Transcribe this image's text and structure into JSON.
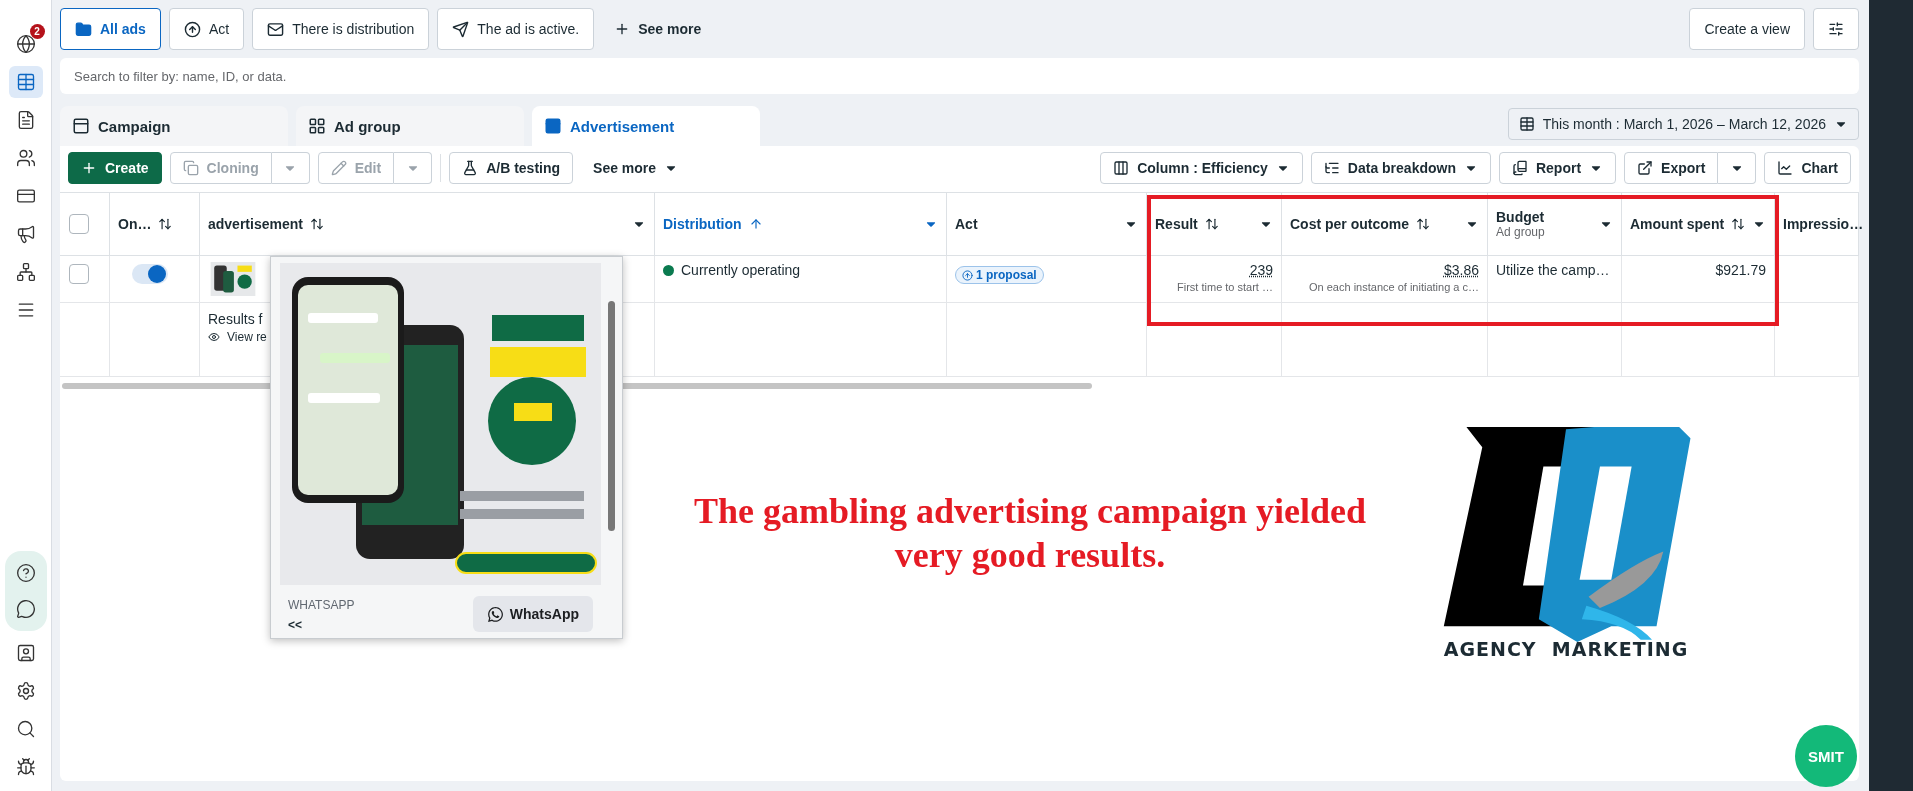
{
  "sidebar": {
    "top_items": [
      {
        "badge": "2",
        "selected": false
      },
      {
        "selected": true
      },
      {
        "selected": false
      },
      {
        "selected": false
      },
      {
        "selected": false
      },
      {
        "selected": false
      },
      {
        "selected": false
      },
      {
        "selected": false
      }
    ],
    "help_items": [
      {
        "selected": false
      },
      {
        "selected": false
      }
    ],
    "bottom_items": [
      {
        "selected": false
      },
      {
        "selected": false
      },
      {
        "selected": false
      },
      {
        "selected": false
      }
    ]
  },
  "filters": [
    {
      "label": "All ads",
      "selected": true
    },
    {
      "label": "Act",
      "selected": false
    },
    {
      "label": "There is distribution",
      "selected": false
    },
    {
      "label": "The ad is active.",
      "selected": false
    }
  ],
  "see_more_filters": "See more",
  "create_view": "Create a view",
  "search": {
    "placeholder": "Search to filter by: name, ID, or data."
  },
  "level_tabs": [
    {
      "label": "Campaign",
      "selected": false
    },
    {
      "label": "Ad group",
      "selected": false
    },
    {
      "label": "Advertisement",
      "selected": true
    }
  ],
  "date_range": "This month : March 1, 2026 – March 12, 2026",
  "toolbar_left": [
    {
      "kind": "primary",
      "label": "Create",
      "disabled": false
    },
    {
      "kind": "split",
      "label": "Cloning",
      "disabled": true
    },
    {
      "kind": "split",
      "label": "Edit",
      "disabled": true
    },
    {
      "kind": "outline",
      "label": "A/B testing",
      "disabled": false
    },
    {
      "kind": "menu",
      "label": "See more",
      "disabled": false
    }
  ],
  "toolbar_right": [
    {
      "kind": "menu",
      "label": "Column : Efficiency"
    },
    {
      "kind": "menu",
      "label": "Data breakdown"
    },
    {
      "kind": "menu",
      "label": "Report"
    },
    {
      "kind": "split",
      "label": "Export"
    },
    {
      "kind": "plain",
      "label": "Chart"
    }
  ],
  "table": {
    "all_checked": false,
    "columns": [
      {
        "label": "On…",
        "sortable": true,
        "menu": false,
        "active": false
      },
      {
        "label": "advertisement",
        "sortable": true,
        "menu": true,
        "active": false
      },
      {
        "label": "Distribution",
        "sortable": true,
        "menu": true,
        "active": true
      },
      {
        "label": "Act",
        "sortable": false,
        "menu": true,
        "active": false
      },
      {
        "label": "Result",
        "sortable": true,
        "menu": true,
        "active": false
      },
      {
        "label": "Cost per outcome",
        "sortable": true,
        "menu": true,
        "active": false
      },
      {
        "label": "Budget",
        "sublabel": "Ad group",
        "sortable": false,
        "menu": true,
        "active": false
      },
      {
        "label": "Amount spent",
        "sortable": true,
        "menu": true,
        "active": false
      },
      {
        "label": "Impressio…",
        "menu": false,
        "active": false
      }
    ],
    "row": {
      "checked": false,
      "on": true,
      "distribution": {
        "label": "Currently operating",
        "color": "#0a7a4f"
      },
      "proposal": "1 proposal",
      "result": "239",
      "result_note": "First time to start …",
      "cost": "$3.86",
      "cost_note": "On each instance of initiating a c…",
      "budget": "Utilize the camp…",
      "spent": "$921.79"
    },
    "summary": {
      "title": "Results f",
      "view": "View re"
    }
  },
  "preview": {
    "source": "WHATSAPP",
    "back": "<<",
    "cta": "WhatsApp"
  },
  "caption": [
    "The gambling advertising campaign yielded",
    "very good results."
  ],
  "logo_text": "AGENCY  MARKETING",
  "smit_button": "SMIT"
}
